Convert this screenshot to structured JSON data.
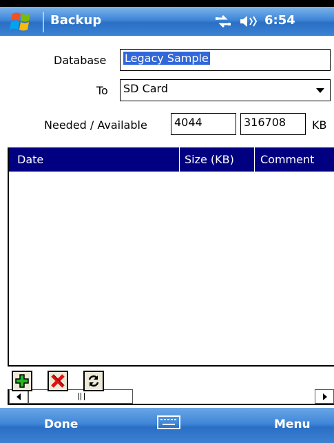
{
  "title_bar": {
    "app_title": "Backup",
    "clock": "6:54"
  },
  "form": {
    "database_label": "Database",
    "database_value": "Legacy Sample",
    "to_label": "To",
    "to_value": "SD Card",
    "needed_available_label": "Needed / Available",
    "needed_value": "4044",
    "available_value": "316708",
    "unit": "KB"
  },
  "table": {
    "columns": [
      "Date",
      "Size (KB)",
      "Comment"
    ],
    "rows": []
  },
  "menu_bar": {
    "left": "Done",
    "right": "Menu"
  },
  "colors": {
    "title_bar": "#3e86d8",
    "list_header": "#000080",
    "selection": "#3167d8"
  }
}
